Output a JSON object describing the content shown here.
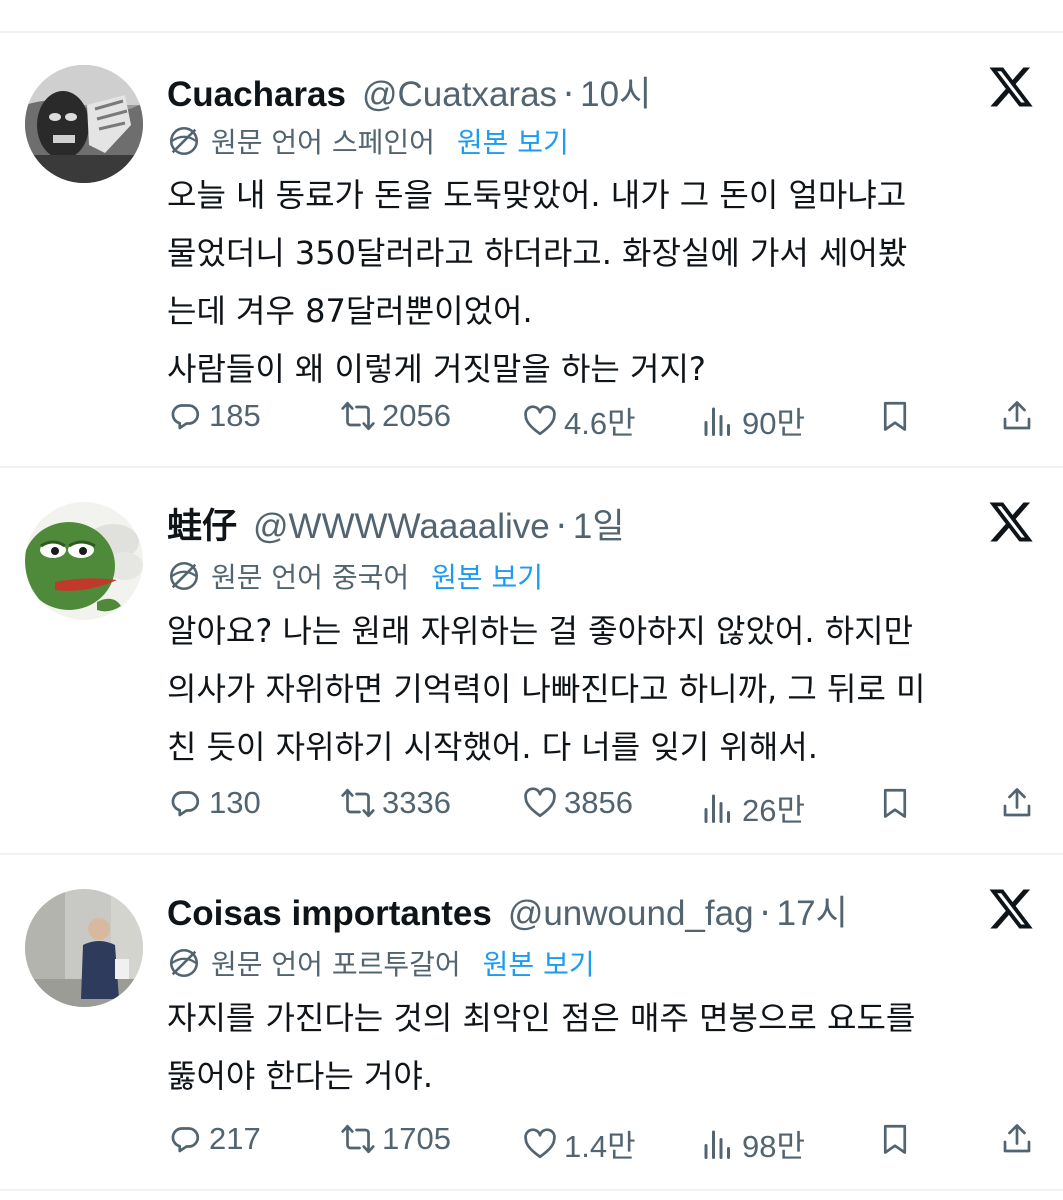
{
  "tweets": [
    {
      "name": "Cuacharas",
      "handle": "@Cuatxaras",
      "dot": "·",
      "time": "10시",
      "translate_lang": "원문 언어 스페인어",
      "translate_link": "원본 보기",
      "lines": [
        "오늘 내 동료가 돈을 도둑맞았어. 내가 그 돈이 얼마냐고",
        "물었더니 350달러라고 하더라고. 화장실에 가서 세어봤",
        "는데 겨우 87달러뿐이었어.",
        "사람들이 왜 이렇게 거짓말을 하는 거지?"
      ],
      "replies": "185",
      "retweets": "2056",
      "likes": "4.6만",
      "views": "90만"
    },
    {
      "name": "蛙仔",
      "handle": "@WWWWaaaalive",
      "dot": "·",
      "time": "1일",
      "translate_lang": "원문 언어 중국어",
      "translate_link": "원본 보기",
      "lines": [
        "알아요? 나는 원래 자위하는 걸 좋아하지 않았어. 하지만",
        "의사가 자위하면 기억력이 나빠진다고 하니까, 그 뒤로 미",
        "친 듯이 자위하기 시작했어. 다 너를 잊기 위해서."
      ],
      "replies": "130",
      "retweets": "3336",
      "likes": "3856",
      "views": "26만"
    },
    {
      "name": "Coisas importantes",
      "handle": "@unwound_fag",
      "dot": "·",
      "time": "17시",
      "translate_lang": "원문 언어 포르투갈어",
      "translate_link": "원본 보기",
      "lines": [
        "자지를 가진다는 것의 최악인 점은 매주 면봉으로 요도를",
        "뚫어야 한다는 거야."
      ],
      "replies": "217",
      "retweets": "1705",
      "likes": "1.4만",
      "views": "98만"
    }
  ],
  "colors": {
    "text": "#0f1419",
    "secondary": "#536471",
    "link": "#1d9bf0",
    "divider": "#eff3f4"
  },
  "icons": [
    "reply-icon",
    "retweet-icon",
    "like-icon",
    "views-icon",
    "bookmark-icon",
    "share-icon",
    "x-logo-icon",
    "translate-globe-icon"
  ]
}
